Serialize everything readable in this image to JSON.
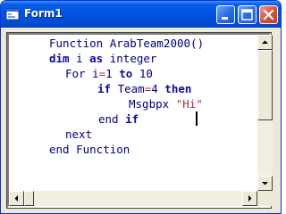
{
  "window": {
    "title": "Form1",
    "colors": {
      "titlebar": "#0053e1",
      "close": "#d8553a",
      "keyword": "#0b0b9e",
      "string": "#b0303a"
    }
  },
  "titlebar_buttons": {
    "minimize": "minimize-icon",
    "maximize": "maximize-icon",
    "close": "close-icon"
  },
  "code": {
    "lines": [
      [
        {
          "t": "Function ArabTeam2000()",
          "c": "tx"
        }
      ],
      [
        {
          "t": "dim",
          "c": "kw"
        },
        {
          "t": " i ",
          "c": "tx"
        },
        {
          "t": "as",
          "c": "kw"
        },
        {
          "t": " integer",
          "c": "tx"
        }
      ],
      [
        {
          "t": "For i",
          "c": "tx"
        },
        {
          "t": "=",
          "c": "st"
        },
        {
          "t": "1 ",
          "c": "tx"
        },
        {
          "t": "to",
          "c": "kw"
        },
        {
          "t": " 10",
          "c": "tx"
        }
      ],
      [
        {
          "t": "if",
          "c": "kw"
        },
        {
          "t": " Team",
          "c": "tx"
        },
        {
          "t": "=",
          "c": "st"
        },
        {
          "t": "4 ",
          "c": "tx"
        },
        {
          "t": "then",
          "c": "kw"
        }
      ],
      [
        {
          "t": "Msgbpx ",
          "c": "tx"
        },
        {
          "t": "\"Hi\"",
          "c": "st"
        }
      ],
      [
        {
          "t": "end ",
          "c": "tx"
        },
        {
          "t": "if",
          "c": "kw"
        }
      ],
      [
        {
          "t": "next",
          "c": "tx"
        }
      ],
      [
        {
          "t": "end Function",
          "c": "tx"
        }
      ]
    ]
  }
}
